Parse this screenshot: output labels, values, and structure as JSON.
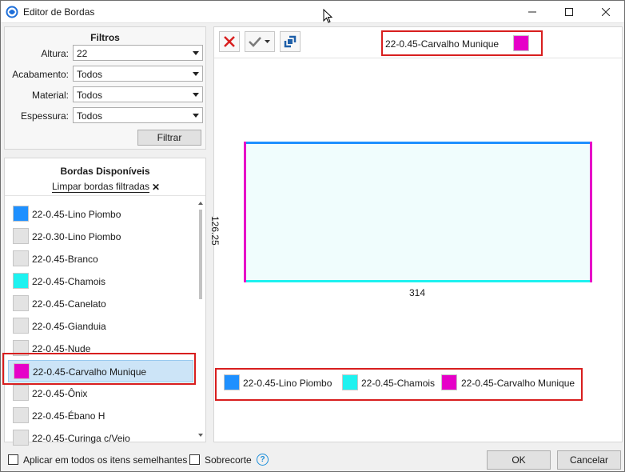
{
  "window": {
    "title": "Editor de Bordas"
  },
  "filters": {
    "title": "Filtros",
    "fields": [
      {
        "label": "Altura:",
        "value": "22"
      },
      {
        "label": "Acabamento:",
        "value": "Todos"
      },
      {
        "label": "Material:",
        "value": "Todos"
      },
      {
        "label": "Espessura:",
        "value": "Todos"
      }
    ],
    "filter_button": "Filtrar"
  },
  "edges": {
    "title": "Bordas Disponíveis",
    "clear_label": "Limpar bordas filtradas",
    "items": [
      {
        "label": "22-0.45-Lino Piombo",
        "color": "#1e90ff"
      },
      {
        "label": "22-0.30-Lino Piombo",
        "color": "#e3e3e3"
      },
      {
        "label": "22-0.45-Branco",
        "color": "#e3e3e3"
      },
      {
        "label": "22-0.45-Chamois",
        "color": "#1ef2f0"
      },
      {
        "label": "22-0.45-Canelato",
        "color": "#e3e3e3"
      },
      {
        "label": "22-0.45-Gianduia",
        "color": "#e3e3e3"
      },
      {
        "label": "22-0.45-Nude",
        "color": "#e3e3e3"
      },
      {
        "label": "22-0.45-Carvalho Munique",
        "color": "#e600c8",
        "selected": true
      },
      {
        "label": "22-0.45-Ônix",
        "color": "#e3e3e3"
      },
      {
        "label": "22-0.45-Ébano H",
        "color": "#e3e3e3"
      },
      {
        "label": "22-0.45-Curinga c/Veio",
        "color": "#e3e3e3"
      }
    ]
  },
  "preview": {
    "selected_edge": "22-0.45-Carvalho Munique",
    "selected_color": "#e600c8",
    "width_value": "314",
    "height_value": "126.25",
    "edge_colors": {
      "top": "#1e90ff",
      "bottom": "#1ef2f0",
      "left": "#e600c8",
      "right": "#e600c8"
    },
    "legend": [
      {
        "label": "22-0.45-Lino Piombo",
        "color": "#1e90ff"
      },
      {
        "label": "22-0.45-Chamois",
        "color": "#1ef2f0"
      },
      {
        "label": "22-0.45-Carvalho Munique",
        "color": "#e600c8"
      }
    ]
  },
  "footer": {
    "apply_all_label": "Aplicar em todos os itens semelhantes",
    "overcut_label": "Sobrecorte",
    "help_glyph": "?",
    "ok_label": "OK",
    "cancel_label": "Cancelar"
  },
  "colors": {
    "highlight": "#d81e1e",
    "selection": "#cce4f7"
  }
}
